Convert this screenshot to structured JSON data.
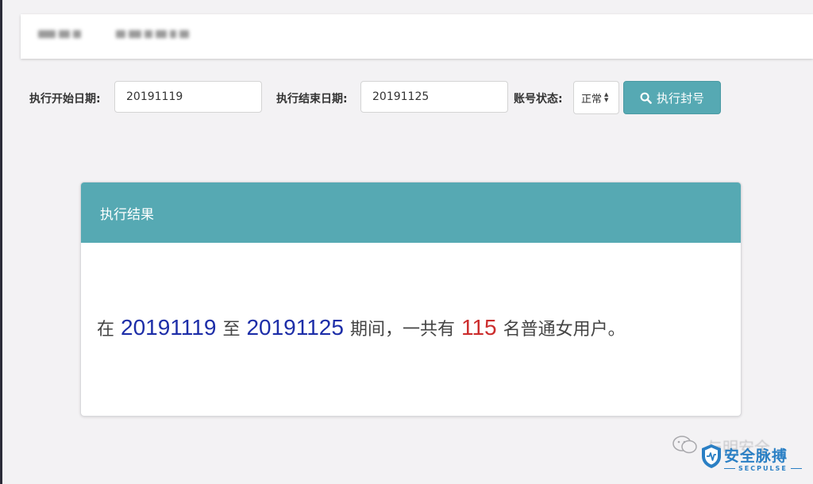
{
  "filters": {
    "start_label": "执行开始日期:",
    "start_value": "20191119",
    "end_label": "执行结束日期:",
    "end_value": "20191125",
    "status_label": "账号状态:",
    "status_selected": "正常",
    "submit_label": "执行封号"
  },
  "panel": {
    "title": "执行结果",
    "result": {
      "prefix": "在",
      "start": "20191119",
      "mid": "至",
      "end": "20191125",
      "middle_text": "期间，一共有",
      "count": "115",
      "suffix": "名普通女用户。"
    }
  },
  "watermark": {
    "faded_text": "与明安全",
    "brand": "安全脉搏",
    "brand_en": "SECPULSE"
  },
  "colors": {
    "accent": "#56a9b3",
    "date_highlight": "#1d2ea8",
    "count_highlight": "#cc2d2d",
    "brand": "#2a7fc4"
  },
  "icons": {
    "submit": "search-icon",
    "status_select": "sort-arrows-icon",
    "watermark_chat": "wechat-icon",
    "watermark_logo": "shield-logo"
  }
}
